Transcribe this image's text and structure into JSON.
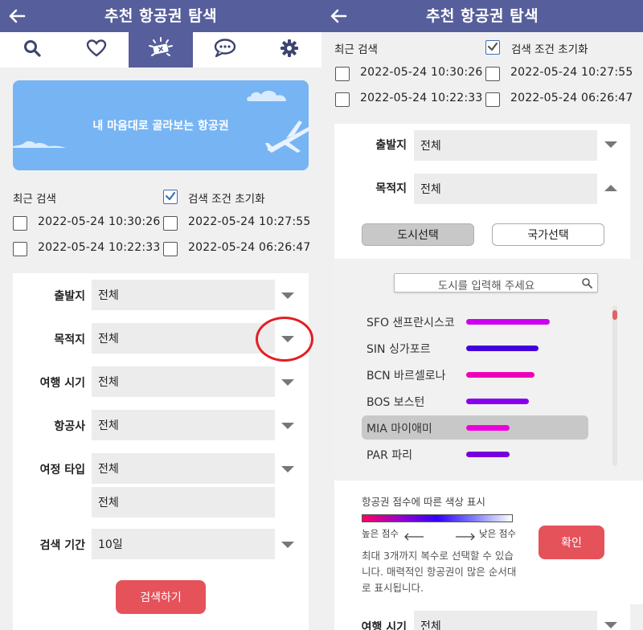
{
  "app_title": "추천 항공권 탐색",
  "tab_icons": [
    "search-icon",
    "heart-icon",
    "ticket-icon",
    "chat-icon",
    "gear-icon"
  ],
  "banner": {
    "text": "내 마음대로 골라보는 항공권"
  },
  "recent": {
    "label": "최근 검색",
    "reset_label": "검색 조건 초기화",
    "items": [
      "2022-05-24 10:30:26",
      "2022-05-24 10:27:55",
      "2022-05-24 10:22:33",
      "2022-05-24 06:26:47"
    ]
  },
  "filters": {
    "origin": {
      "label": "출발지",
      "value": "전체"
    },
    "destination": {
      "label": "목적지",
      "value": "전체"
    },
    "season": {
      "label": "여행 시기",
      "value": "전체"
    },
    "airline": {
      "label": "항공사",
      "value": "전체"
    },
    "trip_type": {
      "label": "여정 타입",
      "value": "전체",
      "value2": "전체"
    },
    "period": {
      "label": "검색 기간",
      "value": "10일"
    }
  },
  "search_button": "검색하기",
  "city_picker": {
    "city_tab": "도시선택",
    "country_tab": "국가선택",
    "placeholder": "도시를 입력해 주세요",
    "cities": [
      {
        "name": "SFO 샌프란시스코",
        "score": 0.88,
        "color": "#cc00ee"
      },
      {
        "name": "SIN 싱가포르",
        "score": 0.76,
        "color": "#4400dd"
      },
      {
        "name": "BCN 바르셀로나",
        "score": 0.72,
        "color": "#ee00bb"
      },
      {
        "name": "BOS 보스턴",
        "score": 0.66,
        "color": "#8800ee"
      },
      {
        "name": "MIA 마이애미",
        "score": 0.46,
        "color": "#ee00dd"
      },
      {
        "name": "PAR 파리",
        "score": 0.46,
        "color": "#7700dd"
      }
    ],
    "selected_index": 4,
    "legend_title": "항공권 점수에 따른 색상 표시",
    "legend_high": "높은 점수",
    "legend_low": "낮은 점수",
    "note": "최대 3개까지 복수로 선택할 수 있습니다. 매력적인 항공권이 많은 순서대로 표시됩니다.",
    "confirm": "확인"
  },
  "colors": {
    "header": "#565f9b",
    "accent": "#e6525a",
    "banner": "#77b4f3",
    "highlight": "#e31d24"
  }
}
